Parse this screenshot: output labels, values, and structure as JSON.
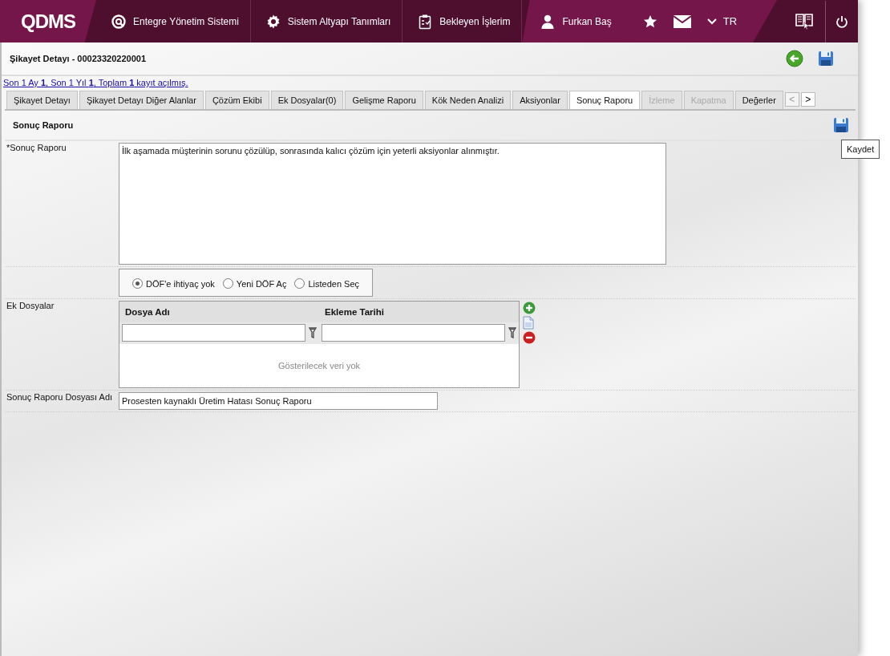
{
  "header": {
    "logo": "QDMS",
    "nav": [
      {
        "kind": "target",
        "label": "Entegre Yönetim Sistemi"
      },
      {
        "kind": "gear",
        "label": "Sistem Altyapı Tanımları"
      },
      {
        "kind": "clipboard",
        "label": "Bekleyen İşlerim"
      }
    ],
    "user": "Furkan Baş",
    "language": "TR"
  },
  "page": {
    "title": "Şikayet Detayı - 00023320220001",
    "record_summary": "Son 1 Ay **1**, Son 1 Yıl **1**, Toplam **1** kayıt açılmış."
  },
  "tabs": [
    {
      "label": "Şikayet Detayı",
      "selected": false,
      "disabled": false
    },
    {
      "label": "Şikayet Detayı Diğer Alanlar",
      "selected": false,
      "disabled": false
    },
    {
      "label": "Çözüm Ekibi",
      "selected": false,
      "disabled": false
    },
    {
      "label": "Ek Dosyalar(0)",
      "selected": false,
      "disabled": false
    },
    {
      "label": "Gelişme Raporu",
      "selected": false,
      "disabled": false
    },
    {
      "label": "Kök Neden Analizi",
      "selected": false,
      "disabled": false
    },
    {
      "label": "Aksiyonlar",
      "selected": false,
      "disabled": false
    },
    {
      "label": "Sonuç Raporu",
      "selected": true,
      "disabled": false
    },
    {
      "label": "İzleme",
      "selected": false,
      "disabled": true
    },
    {
      "label": "Kapatma",
      "selected": false,
      "disabled": true
    },
    {
      "label": "Değerler",
      "selected": false,
      "disabled": false
    }
  ],
  "tab_scroll": [
    "<",
    ">"
  ],
  "section": {
    "title": "Sonuç Raporu",
    "tooltip": "Kaydet"
  },
  "form": {
    "report_label": "*Sonuç Raporu",
    "report_text": "İlk aşamada müşterinin sorunu çözülüp, sonrasında kalıcı çözüm için yeterli aksiyonlar alınmıştır.",
    "dof_options": [
      {
        "label": "DÖF'e ihtiyaç yok",
        "selected": true
      },
      {
        "label": "Yeni DÖF Aç",
        "selected": false
      },
      {
        "label": "Listeden Seç",
        "selected": false
      }
    ],
    "attachments_label": "Ek Dosyalar",
    "attachments_columns": [
      "Dosya Adı",
      "Ekleme Tarihi"
    ],
    "attachments_empty": "Gösterilecek veri yok",
    "file_name_label": "Sonuç Raporu Dosyası Adı",
    "file_name_value": "Prosesten kaynaklı Üretim Hatası Sonuç Raporu"
  }
}
